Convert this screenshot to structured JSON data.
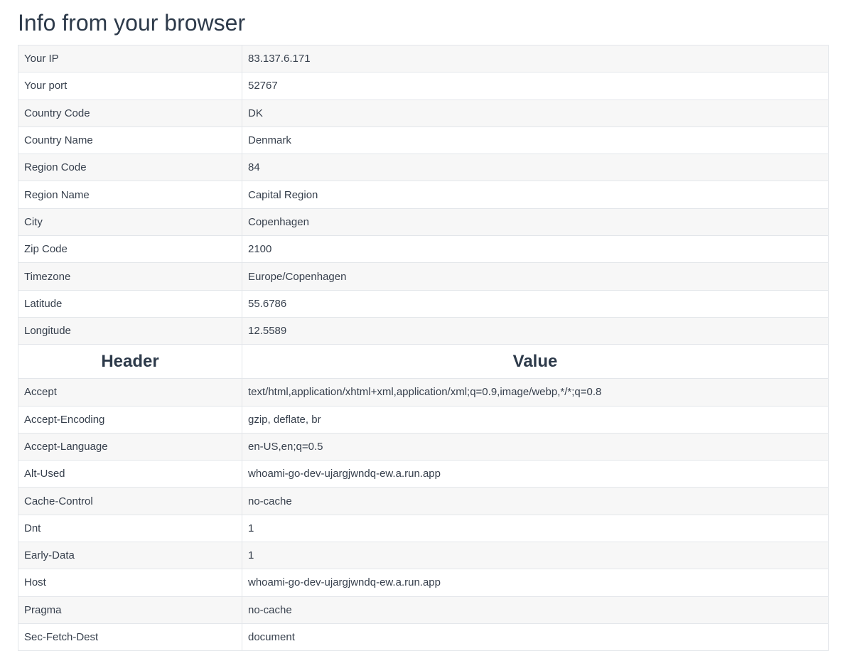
{
  "page": {
    "title": "Info from your browser"
  },
  "info_rows": [
    {
      "label": "Your IP",
      "value": "83.137.6.171"
    },
    {
      "label": "Your port",
      "value": "52767"
    },
    {
      "label": "Country Code",
      "value": "DK"
    },
    {
      "label": "Country Name",
      "value": "Denmark"
    },
    {
      "label": "Region Code",
      "value": "84"
    },
    {
      "label": "Region Name",
      "value": "Capital Region"
    },
    {
      "label": "City",
      "value": "Copenhagen"
    },
    {
      "label": "Zip Code",
      "value": "2100"
    },
    {
      "label": "Timezone",
      "value": "Europe/Copenhagen"
    },
    {
      "label": "Latitude",
      "value": "55.6786"
    },
    {
      "label": "Longitude",
      "value": "12.5589"
    }
  ],
  "headers_table": {
    "col_header": "Header",
    "col_value": "Value",
    "rows": [
      {
        "label": "Accept",
        "value": "text/html,application/xhtml+xml,application/xml;q=0.9,image/webp,*/*;q=0.8"
      },
      {
        "label": "Accept-Encoding",
        "value": "gzip, deflate, br"
      },
      {
        "label": "Accept-Language",
        "value": "en-US,en;q=0.5"
      },
      {
        "label": "Alt-Used",
        "value": "whoami-go-dev-ujargjwndq-ew.a.run.app"
      },
      {
        "label": "Cache-Control",
        "value": "no-cache"
      },
      {
        "label": "Dnt",
        "value": "1"
      },
      {
        "label": "Early-Data",
        "value": "1"
      },
      {
        "label": "Host",
        "value": "whoami-go-dev-ujargjwndq-ew.a.run.app"
      },
      {
        "label": "Pragma",
        "value": "no-cache"
      },
      {
        "label": "Sec-Fetch-Dest",
        "value": "document"
      }
    ]
  }
}
